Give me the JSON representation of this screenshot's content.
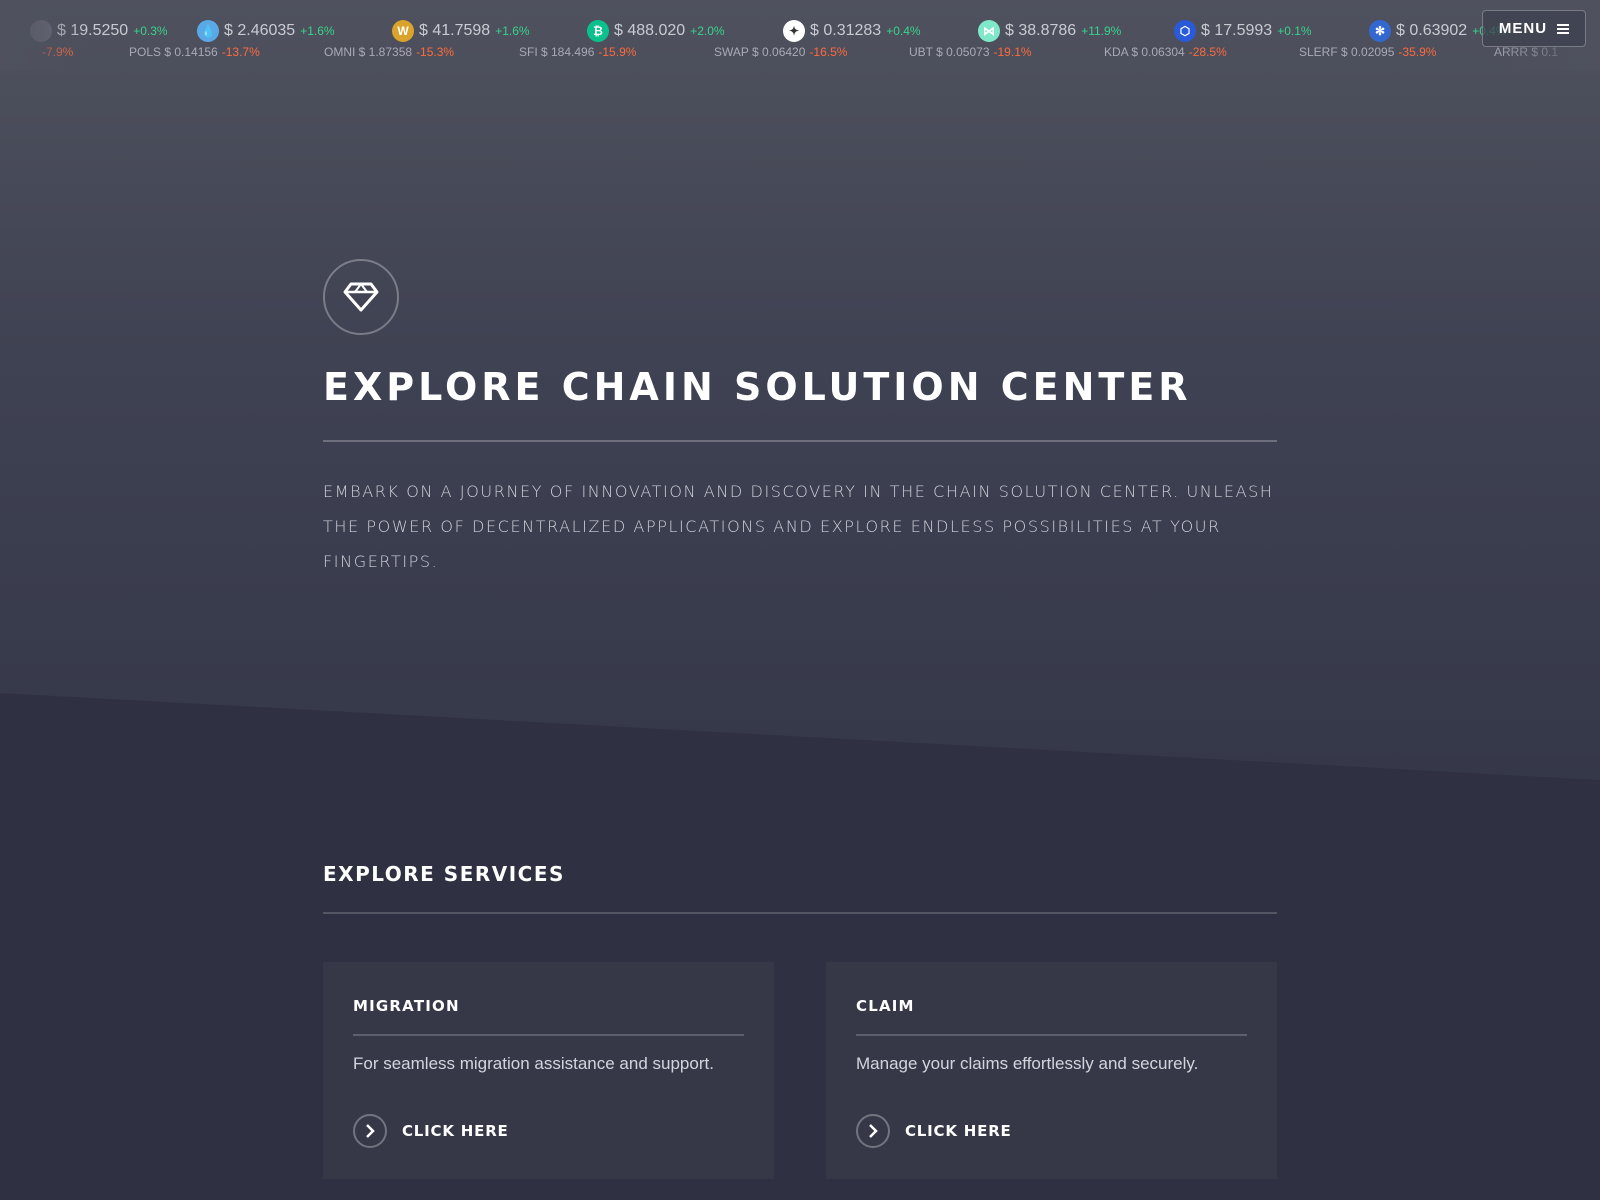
{
  "ticker": {
    "top_row": [
      {
        "icon": "coin-icon",
        "color": "#6b6e7a",
        "symbol_glyph": "",
        "price": "$ 19.5250",
        "change": "+0.3%"
      },
      {
        "icon": "water-drop-icon",
        "color": "#5aa9e6",
        "symbol_glyph": "💧",
        "price": "$ 2.46035",
        "change": "+1.6%"
      },
      {
        "icon": "w-coin-icon",
        "color": "#d9a32c",
        "symbol_glyph": "W",
        "price": "$ 41.7598",
        "change": "+1.6%"
      },
      {
        "icon": "bitcoin-cash-icon",
        "color": "#0ac18e",
        "symbol_glyph": "₿",
        "price": "$ 488.020",
        "change": "+2.0%"
      },
      {
        "icon": "stellar-icon",
        "color": "#ffffff",
        "symbol_glyph": "✦",
        "price": "$ 0.31283",
        "change": "+0.4%"
      },
      {
        "icon": "ribbon-icon",
        "color": "#7ee8c8",
        "symbol_glyph": "⋈",
        "price": "$ 38.8786",
        "change": "+11.9%"
      },
      {
        "icon": "chainlink-icon",
        "color": "#2a5ada",
        "symbol_glyph": "⬡",
        "price": "$ 17.5993",
        "change": "+0.1%"
      },
      {
        "icon": "cardano-icon",
        "color": "#3468d1",
        "symbol_glyph": "✻",
        "price": "$ 0.63902",
        "change": "+0.4%"
      }
    ],
    "bottom_row": [
      {
        "name": "",
        "price": "",
        "change": "-7.9%"
      },
      {
        "name": "POLS",
        "price": "$ 0.14156",
        "change": "-13.7%"
      },
      {
        "name": "OMNI",
        "price": "$ 1.87358",
        "change": "-15.3%"
      },
      {
        "name": "SFI",
        "price": "$ 184.496",
        "change": "-15.9%"
      },
      {
        "name": "SWAP",
        "price": "$ 0.06420",
        "change": "-16.5%"
      },
      {
        "name": "UBT",
        "price": "$ 0.05073",
        "change": "-19.1%"
      },
      {
        "name": "KDA",
        "price": "$ 0.06304",
        "change": "-28.5%"
      },
      {
        "name": "SLERF",
        "price": "$ 0.02095",
        "change": "-35.9%"
      },
      {
        "name": "ARRR",
        "price": "$ 0.1",
        "change": ""
      }
    ]
  },
  "menu": {
    "label": "MENU",
    "icon": "hamburger-icon"
  },
  "hero": {
    "icon": "diamond-icon",
    "title": "EXPLORE CHAIN SOLUTION CENTER",
    "description": "Embark on a journey of innovation and discovery in the Chain Solution Center. Unleash the power of decentralized applications and explore endless possibilities at your fingertips."
  },
  "services": {
    "title": "EXPLORE SERVICES",
    "cards": [
      {
        "title": "MIGRATION",
        "text": "For seamless migration assistance and support.",
        "link_label": "CLICK HERE",
        "link_icon": "chevron-right-icon"
      },
      {
        "title": "CLAIM",
        "text": "Manage your claims effortlessly and securely.",
        "link_label": "CLICK HERE",
        "link_icon": "chevron-right-icon"
      }
    ]
  },
  "colors": {
    "positive": "#38d38a",
    "negative": "#ff6a3d",
    "background": "#2f3142",
    "card": "#363848"
  }
}
